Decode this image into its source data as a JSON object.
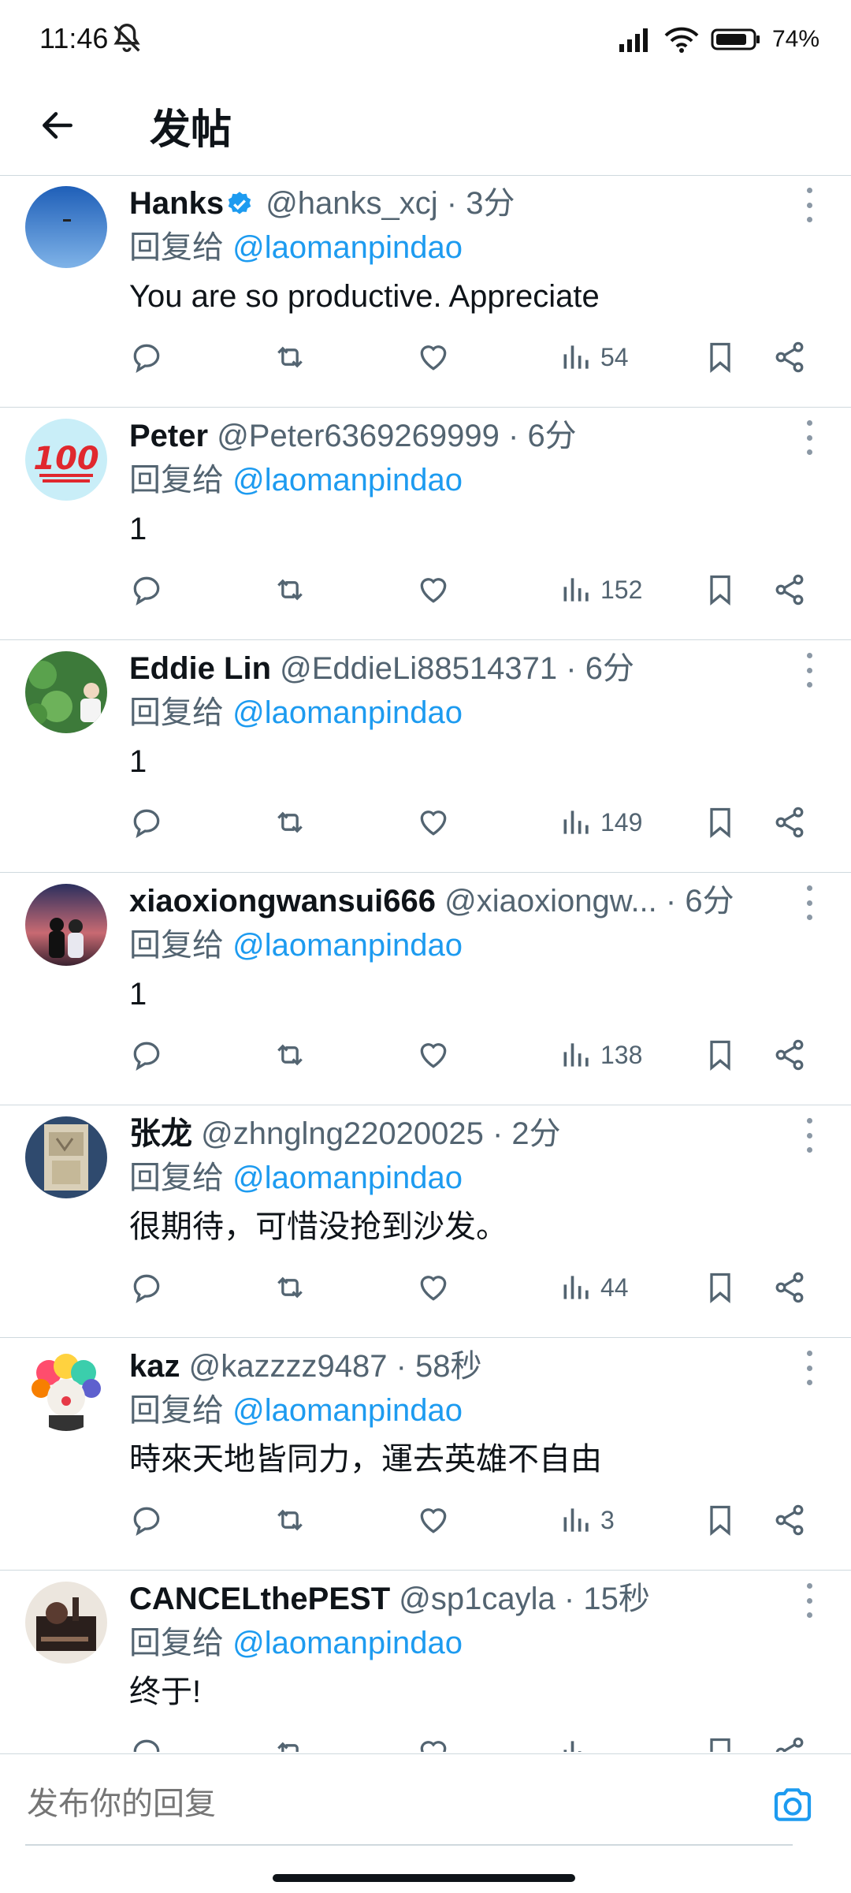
{
  "status_bar": {
    "time": "11:46",
    "battery": "74%"
  },
  "header": {
    "title": "发帖"
  },
  "replies": [
    {
      "name": "Hanks",
      "verified": true,
      "handle": "@hanks_xcj",
      "time": "3分",
      "reply_label": "回复给",
      "reply_to": "@laomanpindao",
      "text": "You are so productive. Appreciate",
      "views": "54"
    },
    {
      "name": "Peter",
      "verified": false,
      "handle": "@Peter6369269999",
      "time": "6分",
      "reply_label": "回复给",
      "reply_to": "@laomanpindao",
      "text": "1",
      "views": "152"
    },
    {
      "name": "Eddie Lin",
      "verified": false,
      "handle": "@EddieLi88514371",
      "time": "6分",
      "reply_label": "回复给",
      "reply_to": "@laomanpindao",
      "text": "1",
      "views": "149"
    },
    {
      "name": "xiaoxiongwansui666",
      "verified": false,
      "handle": "@xiaoxiongw...",
      "time": "6分",
      "reply_label": "回复给",
      "reply_to": "@laomanpindao",
      "text": "1",
      "views": "138"
    },
    {
      "name": "张龙",
      "verified": false,
      "handle": "@zhnglng22020025",
      "time": "2分",
      "reply_label": "回复给",
      "reply_to": "@laomanpindao",
      "text": "很期待，可惜没抢到沙发。",
      "views": "44"
    },
    {
      "name": "kaz",
      "verified": false,
      "handle": "@kazzzz9487",
      "time": "58秒",
      "reply_label": "回复给",
      "reply_to": "@laomanpindao",
      "text": "時來天地皆同力，運去英雄不自由",
      "views": "3"
    },
    {
      "name": "CANCELthePEST",
      "verified": false,
      "handle": "@sp1cayla",
      "time": "15秒",
      "reply_label": "回复给",
      "reply_to": "@laomanpindao",
      "text": "终于!",
      "views": ""
    }
  ],
  "separator": "·",
  "composer": {
    "placeholder": "发布你的回复"
  },
  "icons": {
    "back": "arrow-left-icon",
    "mute": "bell-off-icon",
    "reply": "comment-icon",
    "retweet": "retweet-icon",
    "like": "heart-icon",
    "views": "bar-chart-icon",
    "bookmark": "bookmark-icon",
    "share": "share-icon",
    "more": "more-vertical-icon",
    "camera": "camera-icon",
    "verified": "verified-badge-icon"
  },
  "colors": {
    "accent": "#1d9bf0",
    "text": "#0f1419",
    "secondary": "#536471",
    "divider": "#cfd9de"
  }
}
